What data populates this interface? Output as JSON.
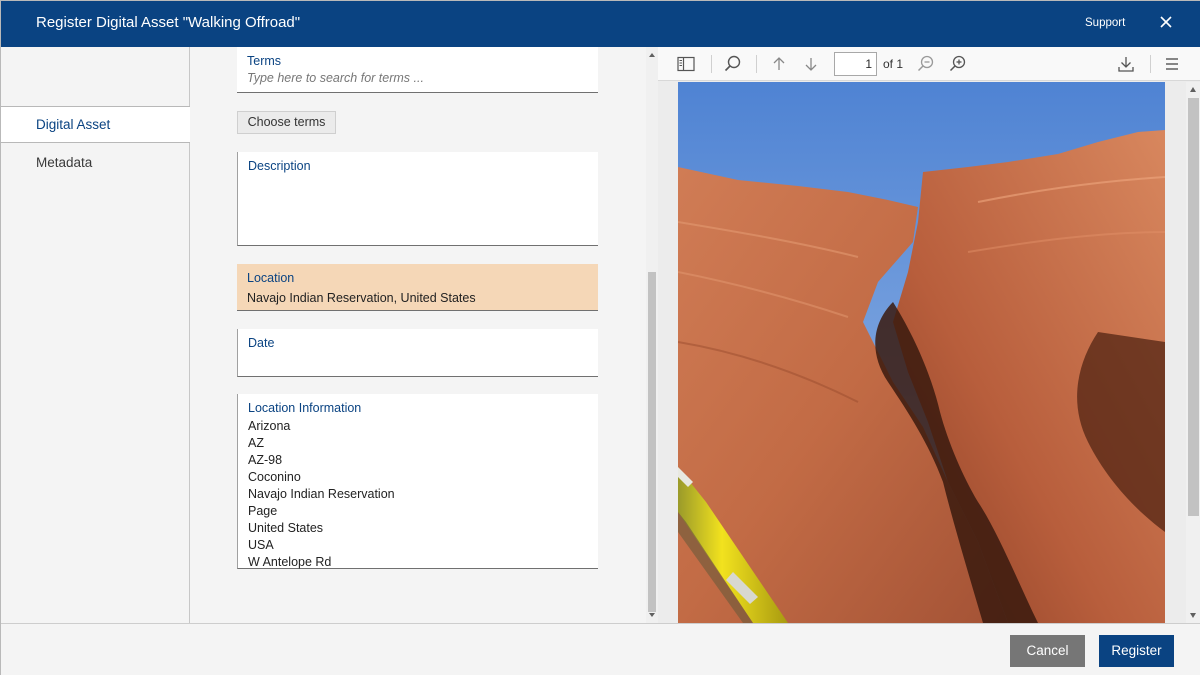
{
  "dialog": {
    "title": "Register Digital Asset \"Walking Offroad\"",
    "support_label": "Support",
    "close_icon": "close-icon"
  },
  "nav": {
    "items": [
      {
        "label": "Digital Asset",
        "active": true
      },
      {
        "label": "Metadata",
        "active": false
      }
    ]
  },
  "form": {
    "terms": {
      "label": "Terms",
      "placeholder": "Type here to search for terms ..."
    },
    "choose_terms_label": "Choose terms",
    "description": {
      "label": "Description",
      "value": ""
    },
    "location": {
      "label": "Location",
      "value": "Navajo Indian Reservation, United States"
    },
    "date": {
      "label": "Date",
      "value": ""
    },
    "location_information": {
      "label": "Location Information",
      "items": [
        "Arizona",
        "AZ",
        "AZ-98",
        "Coconino",
        "Navajo Indian Reservation",
        "Page",
        "United States",
        "USA",
        "W Antelope Rd"
      ]
    }
  },
  "viewer": {
    "page_number": "1",
    "page_total": "of 1",
    "icons": [
      "sidebar-toggle-icon",
      "search-icon",
      "previous-page-icon",
      "next-page-icon",
      "zoom-out-icon",
      "zoom-in-icon",
      "download-icon",
      "menu-icon"
    ]
  },
  "footer": {
    "cancel_label": "Cancel",
    "register_label": "Register"
  },
  "colors": {
    "header_bg": "#0a4382",
    "accent": "#0a4382",
    "location_highlight": "#f5d7b7",
    "cancel_bg": "#767676"
  }
}
